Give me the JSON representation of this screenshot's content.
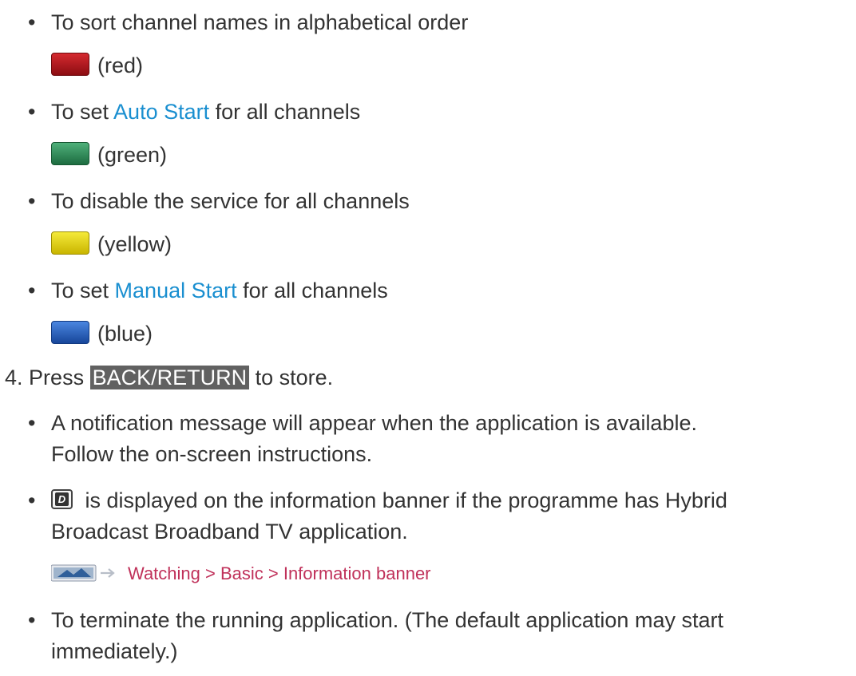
{
  "items": {
    "sort": "To sort channel names in alphabetical order",
    "red": "(red)",
    "auto_prefix": "To set ",
    "auto_link": "Auto Start",
    "auto_suffix": " for all channels",
    "green": "(green)",
    "disable": "To disable the service for all channels",
    "yellow": "(yellow)",
    "manual_prefix": "To set ",
    "manual_link": "Manual Start",
    "manual_suffix": " for all channels",
    "blue": "(blue)"
  },
  "step4": {
    "number": "4.",
    "prefix": "Press ",
    "key": "BACK/RETURN",
    "suffix": " to store."
  },
  "notes": {
    "notification_line1": "A notification message will appear when the application is available.",
    "notification_line2": "Follow the on-screen instructions.",
    "banner_line1_suffix": " is displayed on the information banner if the programme has Hybrid",
    "banner_line2": "Broadcast Broadband TV application.",
    "reference": "Watching > Basic > Information banner",
    "terminate_line1": "To terminate the running application. (The default application may start",
    "terminate_line2": "immediately.)"
  },
  "colors": {
    "red": "#b5161c",
    "green": "#2e8a57",
    "yellow": "#e6d200",
    "blue": "#1f5fbf",
    "link": "#1a8fd0",
    "reference": "#c0315a"
  },
  "icons": {
    "bullet": "bullet-dot",
    "d_button": "data-button-icon",
    "reference": "tv-reference-icon"
  }
}
